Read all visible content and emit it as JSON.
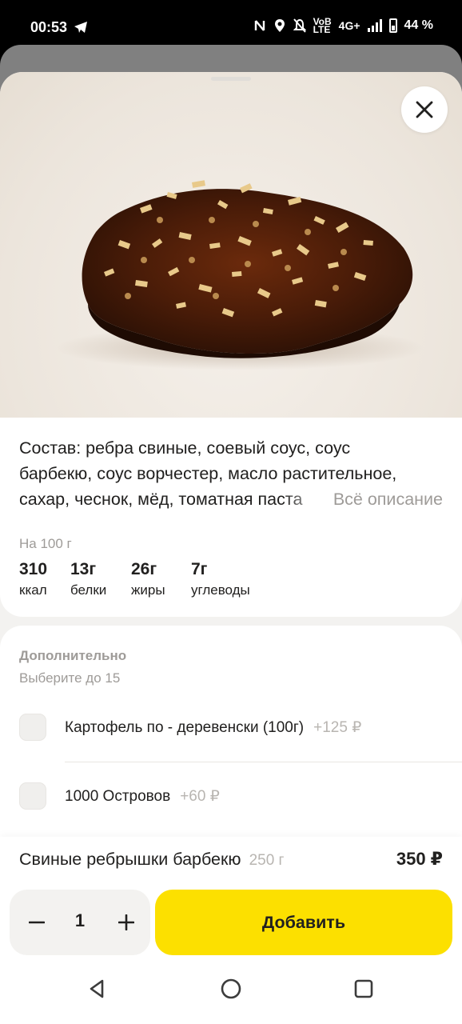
{
  "status_bar": {
    "time": "00:53",
    "net_top": "VoB",
    "net_bottom": "LTE",
    "network": "4G+",
    "battery": "44 %"
  },
  "product": {
    "close_icon": "close-icon",
    "composition_lines": [
      "Состав: ребра свиные, соевый соус, соус",
      "барбекю, соус ворчестер, масло растительное,",
      "сахар, чеснок, мёд, томатная паста"
    ],
    "all_description": "Всё описание",
    "per_100": "На 100 г",
    "nutrition": [
      {
        "value": "310",
        "label": "ккал"
      },
      {
        "value": "13г",
        "label": "белки"
      },
      {
        "value": "26г",
        "label": "жиры"
      },
      {
        "value": "7г",
        "label": "углеводы"
      }
    ]
  },
  "extras": {
    "title": "Дополнительно",
    "subtitle": "Выберите до 15",
    "options": [
      {
        "name": "Картофель по - деревенски (100г)",
        "price": "+125 ₽",
        "checked": false
      },
      {
        "name": "1000 Островов",
        "price": "+60 ₽",
        "checked": false
      }
    ]
  },
  "bottom": {
    "name": "Свиные ребрышки барбекю",
    "weight": "250 г",
    "price": "350 ₽",
    "quantity": "1",
    "add_label": "Добавить"
  },
  "colors": {
    "accent": "#fce000",
    "text": "#21201f",
    "muted": "#9e9b98"
  }
}
